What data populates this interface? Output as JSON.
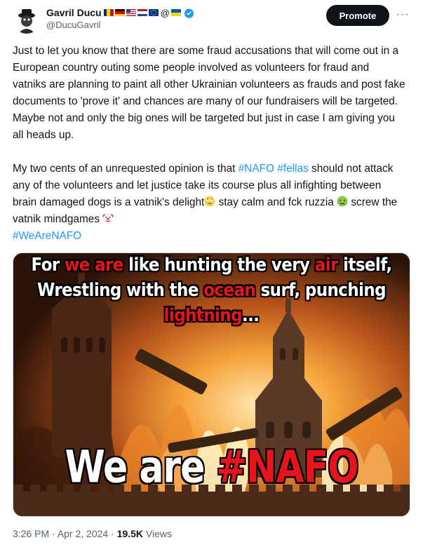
{
  "author": {
    "name": "Gavril Ducu",
    "handle": "@DucuGavril",
    "name_suffix": "@",
    "flags": [
      "Romania",
      "Germany",
      "United States",
      "Netherlands",
      "European Union",
      "Ukraine"
    ]
  },
  "actions": {
    "promote_label": "Promote",
    "more_label": "···"
  },
  "tweet": {
    "p1": "Just to let you know that there are some fraud accusations that will come out in a European country outing some people involved as volunteers for fraud and  vatniks are planning to paint all other Ukrainian volunteers as frauds and post fake documents to 'prove it' and chances are many of our fundraisers will be targeted. Maybe not and only the big ones will be targeted but just in case I am giving you all heads up.",
    "p2_a": "My two cents of an unrequested opinion is that ",
    "hashtag_nafo": "#NAFO",
    "hashtag_fellas": "#fellas",
    "p2_b": " should not attack any of the volunteers and let justice take its course plus all infighting between brain damaged dogs is a vatnik's delight",
    "p2_c": " stay calm and fck ruzzia ",
    "p2_d": " screw the vatnik mindgames ",
    "hashtag_wearenafo": "#WeAreNAFO",
    "emojis": [
      "face-with-rolling-eyes",
      "nauseated-face",
      "clown-face"
    ]
  },
  "image": {
    "line1_a": "For ",
    "line1_red1": "we are",
    "line1_b": " like hunting the very ",
    "line1_red2": "air",
    "line1_c": " itself,",
    "line2_a": "Wrestling with the ",
    "line2_red": "ocean",
    "line2_b": " surf, punching",
    "line3_red": "lightning",
    "line3_b": "...",
    "big_a": "We are ",
    "big_red": "#NAFO"
  },
  "meta": {
    "time": "3:26 PM",
    "sep1": " · ",
    "date": "Apr 2, 2024",
    "sep2": " · ",
    "views_count": "19.5K",
    "views_label": " Views"
  },
  "colors": {
    "link": "#1d9bf0",
    "muted": "#536471",
    "text": "#0f1419",
    "caption_red": "#e8141c",
    "verified": "#1d9bf0"
  }
}
